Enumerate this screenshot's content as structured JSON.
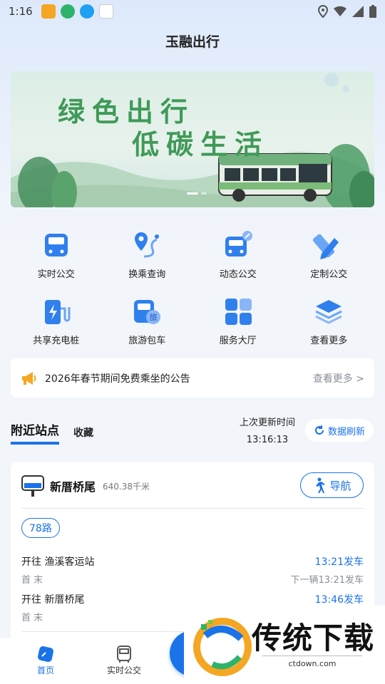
{
  "status_bar": {
    "time": "1:16"
  },
  "header": {
    "title": "玉融出行"
  },
  "banner": {
    "line1": "绿色出行",
    "line2": "低碳生活"
  },
  "services": [
    {
      "label": "实时公交",
      "icon": "realtime-bus-icon"
    },
    {
      "label": "换乘查询",
      "icon": "transfer-route-icon"
    },
    {
      "label": "动态公交",
      "icon": "dynamic-bus-icon"
    },
    {
      "label": "定制公交",
      "icon": "custom-bus-icon"
    },
    {
      "label": "共享充电桩",
      "icon": "charging-pile-icon"
    },
    {
      "label": "旅游包车",
      "icon": "tour-bus-icon"
    },
    {
      "label": "服务大厅",
      "icon": "service-hall-icon"
    },
    {
      "label": "查看更多",
      "icon": "more-layers-icon"
    }
  ],
  "notice": {
    "text": "2026年春节期间免费乘坐的公告",
    "more": "查看更多 >"
  },
  "tabs": {
    "nearby": "附近站点",
    "favorites": "收藏"
  },
  "update": {
    "label": "上次更新时间",
    "time": "13:16:13",
    "refresh": "数据刷新"
  },
  "station": {
    "name": "新厝桥尾",
    "distance": "640.38千米",
    "nav_label": "导航",
    "route": "78路",
    "directions": [
      {
        "to": "开往 渔溪客运站",
        "depart": "13:21发车",
        "first_last": "首 末",
        "next": "下一辆13:21发车"
      },
      {
        "to": "开往 新厝桥尾",
        "depart": "13:46发车",
        "first_last": "首 末",
        "next": ""
      }
    ]
  },
  "bottom_nav": {
    "home": "首页",
    "realtime": "实时公交"
  },
  "watermark": {
    "name": "传统下载",
    "domain": "ctdown.com"
  },
  "colors": {
    "accent": "#1a73e8",
    "banner_green": "#3f9a57"
  }
}
